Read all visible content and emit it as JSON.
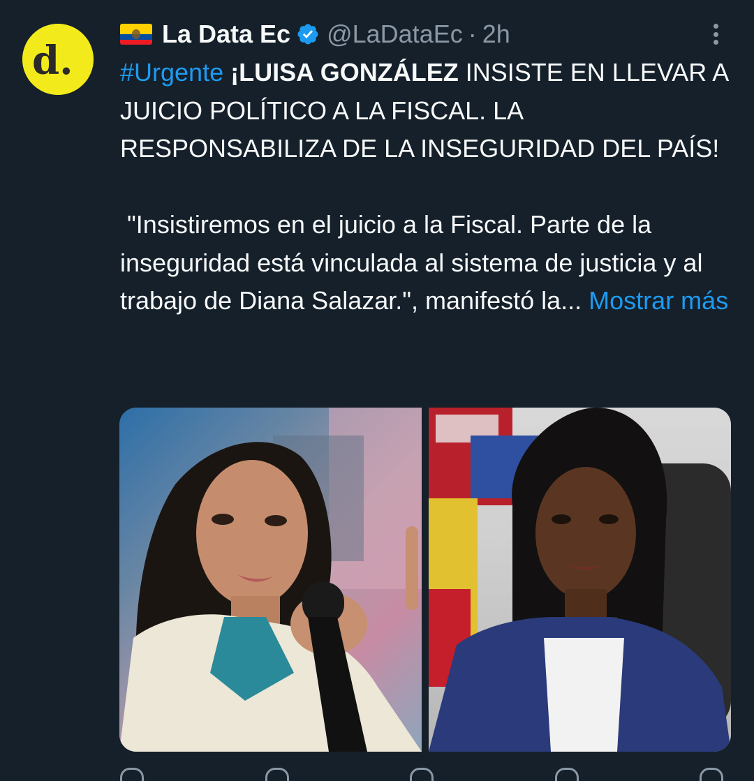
{
  "author": {
    "flag_icon": "ecuador-flag-icon",
    "display_name": "La Data Ec",
    "verified_icon": "verified-badge-icon",
    "handle": "@LaDataEc",
    "separator": "·",
    "time": "2h",
    "avatar_text": "d."
  },
  "tweet": {
    "hashtag": "#Urgente",
    "bold_lead": "¡LUISA GONZÁLEZ",
    "headline_rest": " INSISTE EN LLEVAR A JUICIO POLÍTICO A LA FISCAL. LA RESPONSABILIZA DE LA INSEGURIDAD DEL PAÍS!",
    "quote": " \"Insistiremos en el juicio a la Fiscal. Parte de la inseguridad está vinculada al sistema de justicia y al trabajo de Diana Salazar.\", manifestó la...",
    "show_more": "Mostrar más"
  },
  "actions": {
    "reply_count": "",
    "retweet_count": "",
    "like_count": "",
    "views_count": ""
  },
  "colors": {
    "background": "#15202b",
    "text": "#f7f9f9",
    "muted": "#8b98a5",
    "link": "#1d9bf0",
    "avatar_bg": "#f3ea1b"
  }
}
